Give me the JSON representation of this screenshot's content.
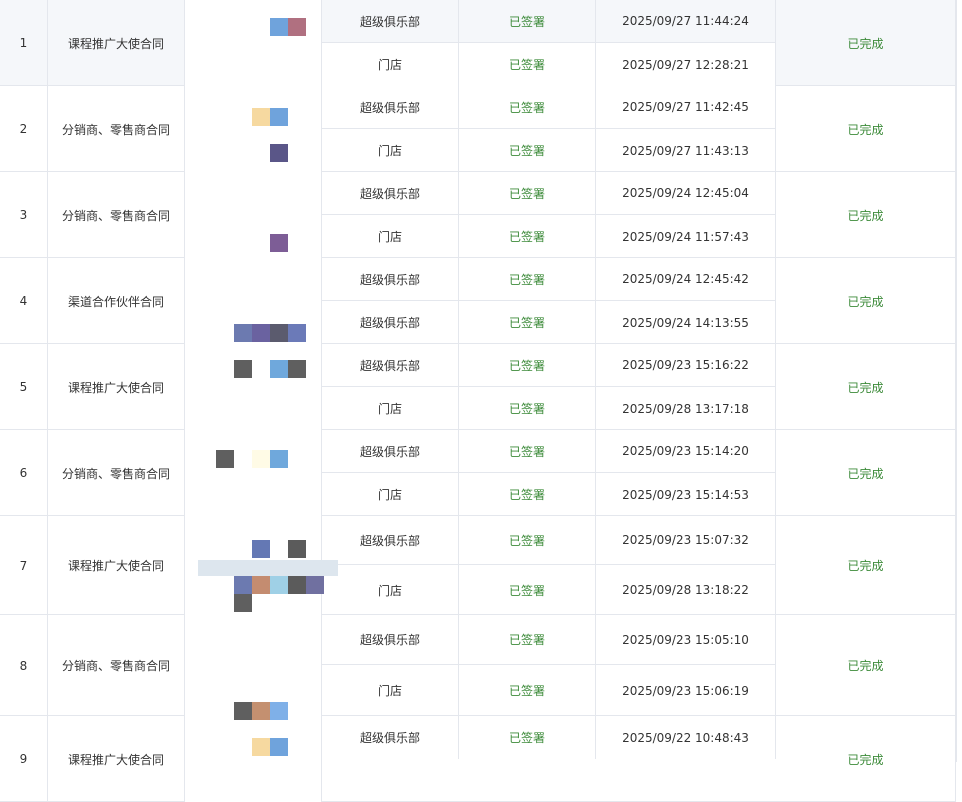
{
  "signing_table": {
    "rows": [
      {
        "index": "1",
        "contract_type": "课程推广大使合同",
        "overall_status": "已完成",
        "parties": [
          {
            "role": "超级俱乐部",
            "status": "已签署",
            "signed_at": "2025/09/27 11:44:24"
          },
          {
            "role": "门店",
            "status": "已签署",
            "signed_at": "2025/09/27 12:28:21"
          }
        ]
      },
      {
        "index": "2",
        "contract_type": "分销商、零售商合同",
        "overall_status": "已完成",
        "parties": [
          {
            "role": "超级俱乐部",
            "status": "已签署",
            "signed_at": "2025/09/27 11:42:45"
          },
          {
            "role": "门店",
            "status": "已签署",
            "signed_at": "2025/09/27 11:43:13"
          }
        ]
      },
      {
        "index": "3",
        "contract_type": "分销商、零售商合同",
        "overall_status": "已完成",
        "parties": [
          {
            "role": "超级俱乐部",
            "status": "已签署",
            "signed_at": "2025/09/24 12:45:04"
          },
          {
            "role": "门店",
            "status": "已签署",
            "signed_at": "2025/09/24 11:57:43"
          }
        ]
      },
      {
        "index": "4",
        "contract_type": "渠道合作伙伴合同",
        "overall_status": "已完成",
        "parties": [
          {
            "role": "超级俱乐部",
            "status": "已签署",
            "signed_at": "2025/09/24 12:45:42"
          },
          {
            "role": "超级俱乐部",
            "status": "已签署",
            "signed_at": "2025/09/24 14:13:55"
          }
        ]
      },
      {
        "index": "5",
        "contract_type": "课程推广大使合同",
        "overall_status": "已完成",
        "parties": [
          {
            "role": "超级俱乐部",
            "status": "已签署",
            "signed_at": "2025/09/23 15:16:22"
          },
          {
            "role": "门店",
            "status": "已签署",
            "signed_at": "2025/09/28 13:17:18"
          }
        ]
      },
      {
        "index": "6",
        "contract_type": "分销商、零售商合同",
        "overall_status": "已完成",
        "parties": [
          {
            "role": "超级俱乐部",
            "status": "已签署",
            "signed_at": "2025/09/23 15:14:20"
          },
          {
            "role": "门店",
            "status": "已签署",
            "signed_at": "2025/09/23 15:14:53"
          }
        ]
      },
      {
        "index": "7",
        "contract_type": "课程推广大使合同",
        "overall_status": "已完成",
        "parties": [
          {
            "role": "超级俱乐部",
            "status": "已签署",
            "signed_at": "2025/09/23 15:07:32"
          },
          {
            "role": "门店",
            "status": "已签署",
            "signed_at": "2025/09/28 13:18:22"
          }
        ]
      },
      {
        "index": "8",
        "contract_type": "分销商、零售商合同",
        "overall_status": "已完成",
        "parties": [
          {
            "role": "超级俱乐部",
            "status": "已签署",
            "signed_at": "2025/09/23 15:05:10"
          },
          {
            "role": "门店",
            "status": "已签署",
            "signed_at": "2025/09/23 15:06:19"
          }
        ]
      },
      {
        "index": "9",
        "contract_type": "课程推广大使合同",
        "overall_status": "已完成",
        "parties": [
          {
            "role": "超级俱乐部",
            "status": "已签署",
            "signed_at": "2025/09/22 10:48:43"
          }
        ]
      }
    ],
    "colors": {
      "status_green": "#3d8b3a",
      "border": "#e4e7ed",
      "highlight_row": "#f5f7fa"
    }
  }
}
